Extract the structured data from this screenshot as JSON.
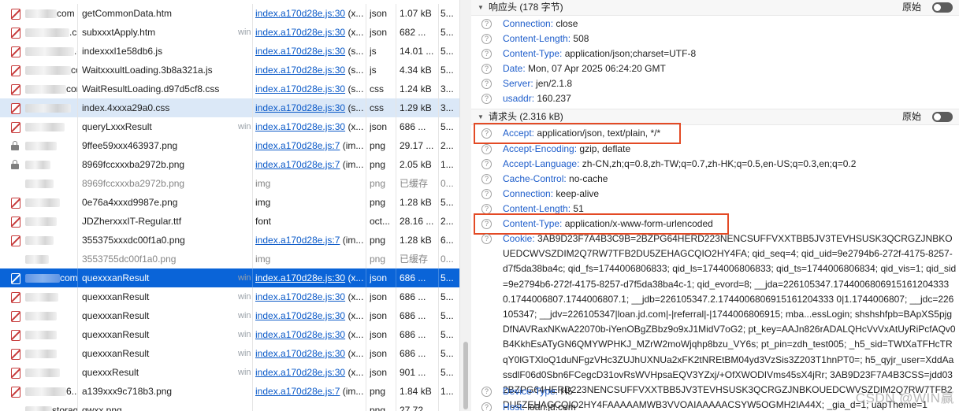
{
  "requests": [
    {
      "icon": "no-image-icon",
      "domain": "com",
      "file": "getCommonData.htm",
      "throttle": "",
      "initiator": "index.a170d28e.js:30",
      "initiator_suffix": "(x...",
      "type": "json",
      "size": "1.07 kB",
      "time": "5...",
      "state": ""
    },
    {
      "icon": "no-image-icon",
      "domain": ".com",
      "file": "subxxxtApply.htm",
      "throttle": "wing",
      "initiator": "index.a170d28e.js:30",
      "initiator_suffix": "(x...",
      "type": "json",
      "size": "682 ...",
      "time": "5...",
      "state": ""
    },
    {
      "icon": "no-image-icon",
      "domain": ".com",
      "file": "indexxxl1e58db6.js",
      "throttle": "",
      "initiator": "index.a170d28e.js:30",
      "initiator_suffix": "(s...",
      "type": "js",
      "size": "14.01 ...",
      "time": "5...",
      "state": ""
    },
    {
      "icon": "no-image-icon",
      "domain": "com",
      "file": "WaitxxxultLoading.3b8a321a.js",
      "throttle": "",
      "initiator": "index.a170d28e.js:30",
      "initiator_suffix": "(s...",
      "type": "js",
      "size": "4.34 kB",
      "time": "5...",
      "state": ""
    },
    {
      "icon": "no-image-icon",
      "domain": "com",
      "file": "WaitResultLoading.d97d5cf8.css",
      "throttle": "",
      "initiator": "index.a170d28e.js:30",
      "initiator_suffix": "(s...",
      "type": "css",
      "size": "1.24 kB",
      "time": "3...",
      "state": ""
    },
    {
      "icon": "no-image-icon",
      "domain": "",
      "file": "index.4xxxa29a0.css",
      "throttle": "",
      "initiator": "index.a170d28e.js:30",
      "initiator_suffix": "(s...",
      "type": "css",
      "size": "1.29 kB",
      "time": "3...",
      "state": "hl"
    },
    {
      "icon": "no-image-icon",
      "domain": "",
      "file": "queryLxxxResult",
      "throttle": "wing",
      "initiator": "index.a170d28e.js:30",
      "initiator_suffix": "(x...",
      "type": "json",
      "size": "686 ...",
      "time": "5...",
      "state": ""
    },
    {
      "icon": "lock-icon",
      "domain": "",
      "file": "9ffee59xxx463937.png",
      "throttle": "",
      "initiator": "index.a170d28e.js:7",
      "initiator_suffix": "(im...",
      "type": "png",
      "size": "29.17 ...",
      "time": "2...",
      "state": ""
    },
    {
      "icon": "lock-icon",
      "domain": "",
      "file": "8969fccxxxba2972b.png",
      "throttle": "",
      "initiator": "index.a170d28e.js:7",
      "initiator_suffix": "(im...",
      "type": "png",
      "size": "2.05 kB",
      "time": "1...",
      "state": ""
    },
    {
      "icon": "none",
      "domain": "",
      "file": "8969fccxxxba2972b.png",
      "throttle": "",
      "initiator": "img",
      "initiator_suffix": "",
      "type": "png",
      "size": "已缓存",
      "time": "0...",
      "state": "grey"
    },
    {
      "icon": "no-image-icon",
      "domain": "",
      "file": "0e76a4xxxd9987e.png",
      "throttle": "",
      "initiator": "img",
      "initiator_suffix": "",
      "type": "png",
      "size": "1.28 kB",
      "time": "5...",
      "state": ""
    },
    {
      "icon": "no-image-icon",
      "domain": "",
      "file": "JDZherxxxIT-Regular.ttf",
      "throttle": "",
      "initiator": "font",
      "initiator_suffix": "",
      "type": "oct...",
      "size": "28.16 ...",
      "time": "2...",
      "state": ""
    },
    {
      "icon": "no-image-icon",
      "domain": "",
      "file": "355375xxxdc00f1a0.png",
      "throttle": "",
      "initiator": "index.a170d28e.js:7",
      "initiator_suffix": "(im...",
      "type": "png",
      "size": "1.28 kB",
      "time": "6...",
      "state": ""
    },
    {
      "icon": "none",
      "domain": "",
      "file": "3553755dc00f1a0.png",
      "throttle": "",
      "initiator": "img",
      "initiator_suffix": "",
      "type": "png",
      "size": "已缓存",
      "time": "0...",
      "state": "grey"
    },
    {
      "icon": "no-image-icon",
      "domain": "com",
      "file": "quexxxanResult",
      "throttle": "wing",
      "initiator": "index.a170d28e.js:30",
      "initiator_suffix": "(x...",
      "type": "json",
      "size": "686 ...",
      "time": "5...",
      "state": "sel"
    },
    {
      "icon": "no-image-icon",
      "domain": "",
      "file": "quexxxanResult",
      "throttle": "wing",
      "initiator": "index.a170d28e.js:30",
      "initiator_suffix": "(x...",
      "type": "json",
      "size": "686 ...",
      "time": "5...",
      "state": ""
    },
    {
      "icon": "no-image-icon",
      "domain": "",
      "file": "quexxxanResult",
      "throttle": "wing",
      "initiator": "index.a170d28e.js:30",
      "initiator_suffix": "(x...",
      "type": "json",
      "size": "686 ...",
      "time": "5...",
      "state": ""
    },
    {
      "icon": "no-image-icon",
      "domain": "",
      "file": "quexxxanResult",
      "throttle": "wing",
      "initiator": "index.a170d28e.js:30",
      "initiator_suffix": "(x...",
      "type": "json",
      "size": "686 ...",
      "time": "5...",
      "state": ""
    },
    {
      "icon": "no-image-icon",
      "domain": "",
      "file": "quexxxanResult",
      "throttle": "wing",
      "initiator": "index.a170d28e.js:30",
      "initiator_suffix": "(x...",
      "type": "json",
      "size": "686 ...",
      "time": "5...",
      "state": ""
    },
    {
      "icon": "no-image-icon",
      "domain": "",
      "file": "quexxxResult",
      "throttle": "wing",
      "initiator": "index.a170d28e.js:30",
      "initiator_suffix": "(x...",
      "type": "json",
      "size": "901 ...",
      "time": "5...",
      "state": ""
    },
    {
      "icon": "no-image-icon",
      "domain": "6...",
      "file": "a139xxx9c718b3.png",
      "throttle": "",
      "initiator": "index.a170d28e.js:7",
      "initiator_suffix": "(im...",
      "type": "png",
      "size": "1.84 kB",
      "time": "1...",
      "state": ""
    },
    {
      "icon": "none",
      "domain": "storage.3...",
      "file": "qwxx.png",
      "throttle": "",
      "initiator": "",
      "initiator_suffix": "",
      "type": "png",
      "size": "27.72 ...",
      "time": "...",
      "state": ""
    }
  ],
  "response_section": {
    "title": "响应头 (178 字节)",
    "raw_label": "原始"
  },
  "response_headers": [
    {
      "name": "Connection:",
      "value": "close"
    },
    {
      "name": "Content-Length:",
      "value": "508"
    },
    {
      "name": "Content-Type:",
      "value": "application/json;charset=UTF-8"
    },
    {
      "name": "Date:",
      "value": "Mon, 07 Apr 2025 06:24:20 GMT"
    },
    {
      "name": "Server:",
      "value": "jen/2.1.8"
    },
    {
      "name": "usaddr:",
      "value": "160.237"
    }
  ],
  "request_section": {
    "title": "请求头 (2.316 kB)",
    "raw_label": "原始"
  },
  "request_headers": [
    {
      "name": "Accept:",
      "value": "application/json, text/plain, */*",
      "boxed": true
    },
    {
      "name": "Accept-Encoding:",
      "value": "gzip, deflate",
      "boxed": false
    },
    {
      "name": "Accept-Language:",
      "value": "zh-CN,zh;q=0.8,zh-TW;q=0.7,zh-HK;q=0.5,en-US;q=0.3,en;q=0.2",
      "boxed": false
    },
    {
      "name": "Cache-Control:",
      "value": "no-cache",
      "boxed": false
    },
    {
      "name": "Connection:",
      "value": "keep-alive",
      "boxed": false
    },
    {
      "name": "Content-Length:",
      "value": "51",
      "boxed": false
    },
    {
      "name": "Content-Type:",
      "value": "application/x-www-form-urlencoded",
      "boxed": true
    }
  ],
  "cookie": {
    "name": "Cookie:",
    "value": "3AB9D23F7A4B3C9B=2BZPG64HERD223NENCSUFFVXXTBB5JV3TEVHSUSK3QCRGZJNBKOUEDCWVSZDIM2Q7RW7TFB2DU5ZEHAGCQIO2HY4FA; qid_seq=4; qid_uid=9e2794b6-272f-4175-8257-d7f5da38ba4c; qid_fs=1744006806833; qid_ls=1744006806833; qid_ts=1744006806834; qid_vis=1; qid_sid=9e2794b6-272f-4175-8257-d7f5da38ba4c-1; qid_evord=8; __jda=226105347.1744006806915161204333 0.1744006807.1744006807.1; __jdb=226105347.2.1744006806915161204333 0|1.1744006807; __jdc=226105347; __jdv=226105347|loan.jd.com|-|referral|-|1744006806915; mba...essLogin; shshshfpb=BApXS5pjgDfNAVRaxNKwA22070b-iYenOBgZBbz9o9xJ1MidV7oG2; pt_key=AAJn826rADALQHcVvVxAtUyRiPcfAQv0B4KkhEsATyGN6QMYWPHKJ_MZrW2moWjqhp8bzu_VY6s; pt_pin=zdh_test005; _h5_sid=TWtXaTFHcTRqY0lGTXloQ1duNFgzVHc3ZUJhUXNUa2xFK2tNREtBM04yd3VzSis3Z203T1hnPT0=; h5_qyjr_user=XddAassdlF06d0Sbn6FCegcD31ovRsWVHpsaEQV3YZxj/+OfXWODIVms45sX4jRr; 3AB9D23F7A4B3CSS=jdd032BZPG64HERD223NENCSUFFVXXTBB5JV3TEVHSUSK3QCRGZJNBKOUEDCWVSZDIM2Q7RW7TFB2DU5ZEHAGCQIO2HY4FAAAAAMWB3VVOAIAAAAACSYW5OGMH2IA44X; _gia_d=1; uapTheme=1"
  },
  "request_headers_after": [
    {
      "name": "Device-Type:",
      "value": "H5"
    },
    {
      "name": "Host:",
      "value": "loan.jd.com"
    }
  ],
  "watermark": "CSDN @WIN赢"
}
